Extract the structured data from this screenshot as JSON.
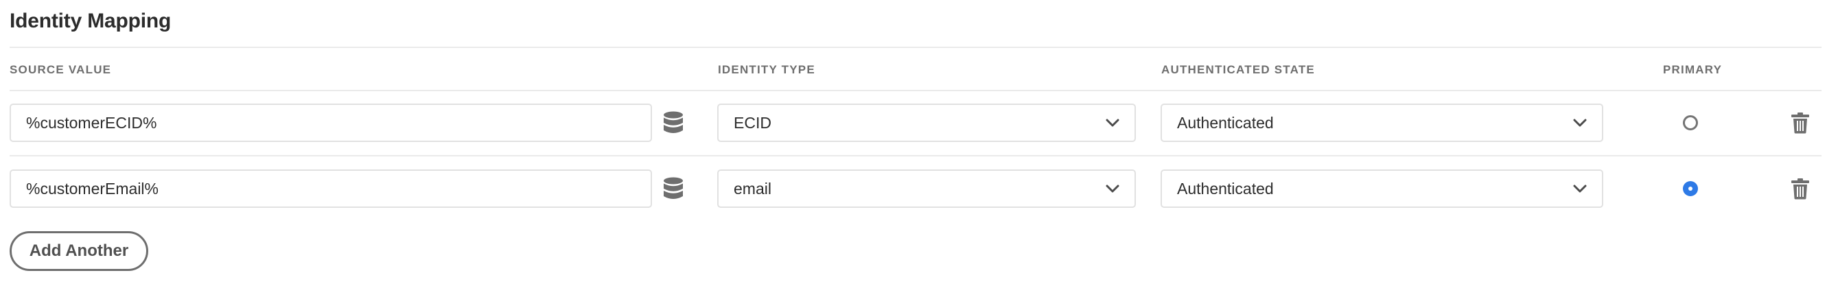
{
  "section": {
    "title": "Identity Mapping"
  },
  "table": {
    "headers": {
      "source_value": "SOURCE VALUE",
      "identity_type": "IDENTITY TYPE",
      "authenticated_state": "AUTHENTICATED STATE",
      "primary": "PRIMARY"
    },
    "rows": [
      {
        "source_value": "%customerECID%",
        "identity_type": "ECID",
        "authenticated_state": "Authenticated",
        "primary": false,
        "data_element_icon": "database-icon",
        "delete_icon": "trash-icon"
      },
      {
        "source_value": "%customerEmail%",
        "identity_type": "email",
        "authenticated_state": "Authenticated",
        "primary": true,
        "data_element_icon": "database-icon",
        "delete_icon": "trash-icon"
      }
    ]
  },
  "actions": {
    "add_another_label": "Add Another"
  },
  "colors": {
    "accent": "#2e7ae6",
    "text": "#2c2c2c",
    "header_text": "#6e6e6e",
    "border": "#e1e1e1",
    "icon": "#6e6e6e"
  }
}
